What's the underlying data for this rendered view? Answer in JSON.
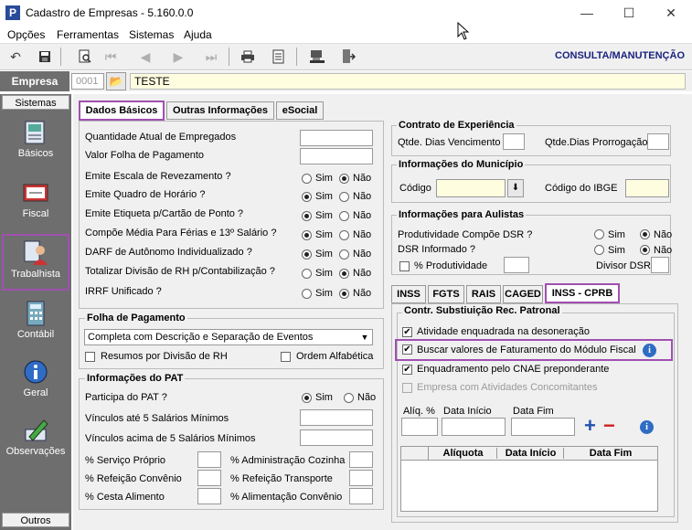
{
  "window": {
    "title": "Cadastro de Empresas - 5.160.0.0",
    "minimize": "—",
    "maximize": "☐",
    "close": "✕"
  },
  "menu": [
    "Opções",
    "Ferramentas",
    "Sistemas",
    "Ajuda"
  ],
  "toolbar": {
    "mode": "CONSULTA/MANUTENÇÃO"
  },
  "empresa": {
    "label": "Empresa",
    "code": "0001",
    "name": "TESTE"
  },
  "sidebar": {
    "header": "Sistemas",
    "footer": "Outros",
    "items": [
      {
        "label": "Básicos",
        "icon": "notebook-icon"
      },
      {
        "label": "Fiscal",
        "icon": "calculator-icon"
      },
      {
        "label": "Trabalhista",
        "icon": "person-icon"
      },
      {
        "label": "Contábil",
        "icon": "calculator-icon"
      },
      {
        "label": "Geral",
        "icon": "info-icon"
      },
      {
        "label": "Observações",
        "icon": "pen-icon"
      }
    ]
  },
  "tabs": [
    "Dados Básicos",
    "Outras Informações",
    "eSocial"
  ],
  "basic": {
    "qtd_empregados": "Quantidade Atual de Empregados",
    "valor_folha": "Valor Folha de Pagamento",
    "questions": [
      {
        "label": "Emite Escala de Revezamento ?",
        "value": "Não"
      },
      {
        "label": "Emite Quadro de Horário ?",
        "value": "Sim"
      },
      {
        "label": "Emite Etiqueta p/Cartão de Ponto ?",
        "value": "Sim"
      },
      {
        "label": "Compõe Média Para Férias e 13º Salário ?",
        "value": "Sim"
      },
      {
        "label": "DARF de Autônomo Individualizado ?",
        "value": "Sim"
      },
      {
        "label": "Totalizar Divisão de RH p/Contabilização ?",
        "value": "Não"
      },
      {
        "label": "IRRF Unificado ?",
        "value": "Não"
      }
    ],
    "sim": "Sim",
    "nao": "Não"
  },
  "folha": {
    "title": "Folha de Pagamento",
    "select_value": "Completa com Descrição e Separação de Eventos",
    "resumos": "Resumos por Divisão de RH",
    "ordem": "Ordem Alfabética"
  },
  "pat": {
    "title": "Informações do PAT",
    "participa": "Participa do PAT ?",
    "participa_value": "Sim",
    "vinc5": "Vínculos até 5 Salários Mínimos",
    "vinc5acima": "Vínculos acima de 5 Salários Mínimos",
    "servico_proprio": "% Serviço Próprio",
    "refeicao_convenio": "% Refeição Convênio",
    "cesta_alimento": "% Cesta Alimento",
    "adm_cozinha": "% Administração Cozinha",
    "refeicao_transporte": "% Refeição Transporte",
    "alimentacao_convenio": "% Alimentação Convênio"
  },
  "experiencia": {
    "title": "Contrato de Experiência",
    "vencimento": "Qtde. Dias Vencimento",
    "prorrogacao": "Qtde.Dias Prorrogação"
  },
  "municipio": {
    "title": "Informações do Município",
    "codigo": "Código",
    "ibge": "Código do IBGE"
  },
  "aulistas": {
    "title": "Informações para Aulistas",
    "dsr": "Produtividade Compõe DSR ?",
    "dsr_value": "Não",
    "dsr_inf": "DSR Informado ?",
    "dsr_inf_value": "Não",
    "pct_prod": "% Produtividade",
    "divisor": "Divisor DSR"
  },
  "subtabs": [
    "INSS",
    "FGTS",
    "RAIS",
    "CAGED",
    "INSS - CPRB"
  ],
  "cprb": {
    "title": "Contr. Substiuição Rec. Patronal",
    "atividade": "Atividade enquadrada na desoneração",
    "buscar": "Buscar valores de Faturamento do Módulo Fiscal",
    "enquadramento": "Enquadramento pelo CNAE preponderante",
    "concomitantes": "Empresa com Atividades Concomitantes",
    "aliq": "Alíq. %",
    "data_inicio": "Data Início",
    "data_fim": "Data Fim",
    "table_headers": [
      "Alíquota",
      "Data Início",
      "Data Fim"
    ]
  }
}
